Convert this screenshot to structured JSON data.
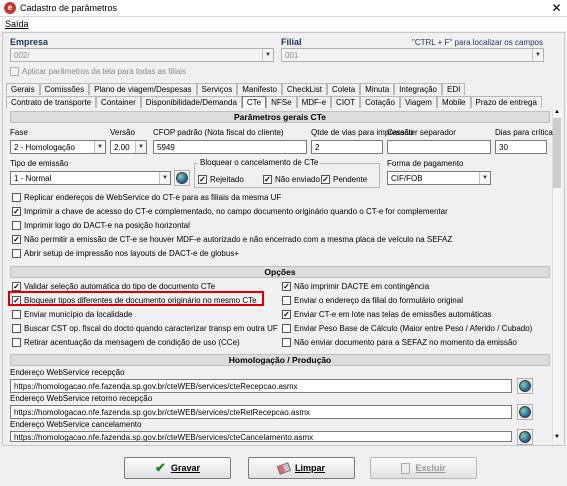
{
  "window": {
    "title": "Cadastro de parâmetros",
    "app_icon": "e",
    "close": "✕"
  },
  "menu": {
    "items": [
      "Saída"
    ]
  },
  "top": {
    "empresa_label": "Empresa",
    "empresa_value": "002/",
    "filial_label": "Filial",
    "filial_value": "001",
    "hint": "\"CTRL + F\" para localizar os campos",
    "apply_all": "Aplicar parâmetros da tela para todas as filiais"
  },
  "tabs_row1": [
    "Gerais",
    "Comissões",
    "Plano de viagem/Despesas",
    "Serviços",
    "Manifesto",
    "CheckList",
    "Coleta",
    "Minuta",
    "Integração",
    "EDI"
  ],
  "tabs_row2": [
    "Contrato de transporte",
    "Container",
    "Disponibilidade/Demanda",
    "CTe",
    "NFSe",
    "MDF-e",
    "CIOT",
    "Cotação",
    "Viagem",
    "Mobile",
    "Prazo de entrega"
  ],
  "active_tab": "CTe",
  "sections": {
    "gerais": "Parâmetros gerais CTe",
    "opcoes": "Opções",
    "homolog": "Homologação / Produção"
  },
  "fields": {
    "fase_label": "Fase",
    "fase_value": "2 - Homologação",
    "versao_label": "Versão",
    "versao_value": "2.00",
    "cfop_label": "CFOP padrão (Nota fiscal do cliente)",
    "cfop_value": "5949",
    "qtde_label": "Qtde de vias para impressão",
    "qtde_value": "2",
    "caracter_label": "Caracter separador",
    "caracter_value": "",
    "dias_label": "Dias para crítica",
    "dias_value": "30",
    "tipo_label": "Tipo de emissão",
    "tipo_value": "1 - Normal",
    "bloquear_label": "Bloquear o cancelamento de CTe",
    "bloq_rejeitado": "Rejeitado",
    "bloq_nao_enviado": "Não enviado",
    "bloq_pendente": "Pendente",
    "forma_label": "Forma de pagamento",
    "forma_value": "CIF/FOB"
  },
  "gerais_checks": [
    {
      "label": "Replicar endereços de WebService do CT-e para as filiais da mesma UF",
      "checked": false
    },
    {
      "label": "Imprimir a chave de acesso do CT-e complementado, no campo documento originário quando o CT-e for complementar",
      "checked": true
    },
    {
      "label": "Imprimir logo do DACT-e na posição horizontal",
      "checked": false
    },
    {
      "label": "Não permitir a emissão de CT-e se houver MDF-e autorizado e não encerrado com a mesma placa de veículo na SEFAZ",
      "checked": true
    },
    {
      "label": "Abrir setup de impressão nos layouts de DACT-e de globus+",
      "checked": false
    }
  ],
  "opcoes_left": [
    {
      "label": "Validar seleção automática do tipo de documento CTe",
      "checked": true
    },
    {
      "label": "Bloquear tipos diferentes de documento originário no mesmo CTe",
      "checked": true
    },
    {
      "label": "Enviar município da localidade",
      "checked": false
    },
    {
      "label": "Buscar CST op. fiscal do docto quando caracterizar transp em outra UF",
      "checked": false
    },
    {
      "label": "Retirar acentuação da mensagem de condição de uso (CCe)",
      "checked": false
    }
  ],
  "opcoes_right": [
    {
      "label": "Não imprimir DACTE em contingência",
      "checked": true
    },
    {
      "label": "Enviar o endereço da filial do formulário original",
      "checked": false
    },
    {
      "label": "Enviar CT-e em lote nas telas de emissões automáticas",
      "checked": true
    },
    {
      "label": "Enviar Peso Base de Cálculo (Maior entre Peso / Aferido / Cubado)",
      "checked": false
    },
    {
      "label": "Não enviar documento para a SEFAZ no momento da emissão",
      "checked": false
    }
  ],
  "webservices": [
    {
      "label": "Endereço WebService recepção",
      "value": "https://homologacao.nfe.fazenda.sp.gov.br/cteWEB/services/cteRecepcao.asmx"
    },
    {
      "label": "Endereço WebService retorno recepção",
      "value": "https://homologacao.nfe.fazenda.sp.gov.br/cteWEB/services/cteRetRecepcao.asmx"
    },
    {
      "label": "Endereço WebService cancelamento",
      "value": "https://homologacao.nfe.fazenda.sp.gov.br/cteWEB/services/cteCancelamento.asmx"
    }
  ],
  "buttons": {
    "gravar": "Gravar",
    "limpar": "Limpar",
    "excluir": "Excluir"
  },
  "colors": {
    "highlight_box": "#e00000",
    "label_blue": "#1f3864"
  }
}
